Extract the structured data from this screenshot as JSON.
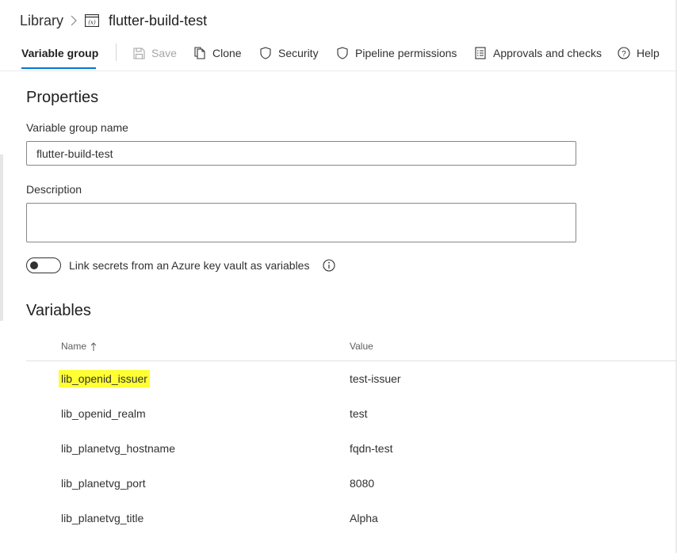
{
  "breadcrumb": {
    "root": "Library",
    "current": "flutter-build-test",
    "current_icon": "variable-group-icon"
  },
  "toolbar": {
    "active_tab": "Variable group",
    "buttons": [
      {
        "label": "Save",
        "icon": "save-icon",
        "enabled": false
      },
      {
        "label": "Clone",
        "icon": "clone-icon",
        "enabled": true
      },
      {
        "label": "Security",
        "icon": "shield-icon",
        "enabled": true
      },
      {
        "label": "Pipeline permissions",
        "icon": "shield-icon",
        "enabled": true
      },
      {
        "label": "Approvals and checks",
        "icon": "checklist-icon",
        "enabled": true
      },
      {
        "label": "Help",
        "icon": "help-icon",
        "enabled": true
      }
    ]
  },
  "properties": {
    "title": "Properties",
    "name_label": "Variable group name",
    "name_value": "flutter-build-test",
    "description_label": "Description",
    "description_value": "",
    "link_secrets_label": "Link secrets from an Azure key vault as variables",
    "link_secrets_enabled": false
  },
  "variables": {
    "title": "Variables",
    "columns": {
      "name": "Name",
      "value": "Value"
    },
    "sort": "ascending",
    "rows": [
      {
        "name": "lib_openid_issuer",
        "value": "test-issuer",
        "highlighted": true
      },
      {
        "name": "lib_openid_realm",
        "value": "test",
        "highlighted": false
      },
      {
        "name": "lib_planetvg_hostname",
        "value": "fqdn-test",
        "highlighted": false
      },
      {
        "name": "lib_planetvg_port",
        "value": "8080",
        "highlighted": false
      },
      {
        "name": "lib_planetvg_title",
        "value": "Alpha",
        "highlighted": false
      }
    ]
  },
  "colors": {
    "accent": "#0078d4",
    "highlight": "#ffff33"
  }
}
